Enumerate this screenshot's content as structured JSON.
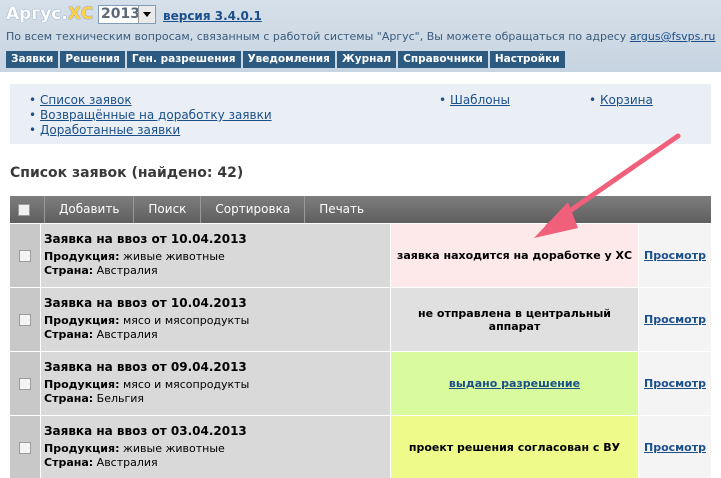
{
  "header": {
    "app_name": "Аргус.",
    "app_suffix": "ХС",
    "year_selected": "2013",
    "version": "версия 3.4.0.1",
    "notice_text": "По всем техническим вопросам, связанным с работой системы \"Аргус\", Вы можете обращаться по адресу ",
    "notice_email": "argus@fsvps.ru"
  },
  "nav": {
    "tabs": [
      "Заявки",
      "Решения",
      "Ген. разрешения",
      "Уведомления",
      "Журнал",
      "Справочники",
      "Настройки"
    ]
  },
  "links": {
    "col1": [
      "Список заявок",
      "Возвращённые на доработку заявки",
      "Доработанные заявки"
    ],
    "col2": [
      "Шаблоны"
    ],
    "col3": [
      "Корзина"
    ]
  },
  "list": {
    "title": "Список заявок (найдено: 42)"
  },
  "toolbar": {
    "buttons": [
      "Добавить",
      "Поиск",
      "Сортировка",
      "Печать"
    ]
  },
  "labels": {
    "product": "Продукция:",
    "country": "Страна:",
    "view": "Просмотр"
  },
  "rows": [
    {
      "title": "Заявка на ввоз от 10.04.2013",
      "product": "живые животные",
      "country": "Австралия",
      "status": "заявка находится на доработке у ХС"
    },
    {
      "title": "Заявка на ввоз от 10.04.2013",
      "product": "мясо и мясопродукты",
      "country": "Австралия",
      "status": "не отправлена в центральный аппарат"
    },
    {
      "title": "Заявка на ввоз от 09.04.2013",
      "product": "мясо и мясопродукты",
      "country": "Бельгия",
      "status": "выдано разрешение"
    },
    {
      "title": "Заявка на ввоз от 03.04.2013",
      "product": "живые животные",
      "country": "Австралия",
      "status": "проект решения согласован с ВУ"
    }
  ],
  "colors": {
    "status_1": "#fde9e9",
    "status_2": "#e0e0e0",
    "status_3": "#d9fb9e",
    "status_4": "#eefb8a",
    "arrow": "#f0607a"
  }
}
